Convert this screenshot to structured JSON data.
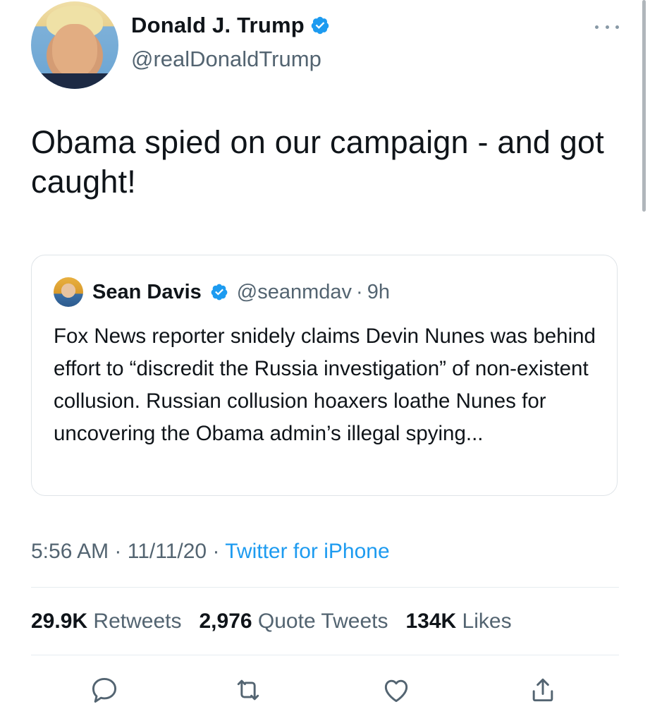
{
  "author": {
    "display_name": "Donald J. Trump",
    "handle": "@realDonaldTrump",
    "verified": true
  },
  "tweet": {
    "text": "Obama spied on our campaign - and got caught!"
  },
  "quoted_tweet": {
    "display_name": "Sean Davis",
    "handle": "@seanmdav",
    "separator": "·",
    "time": "9h",
    "verified": true,
    "text": "Fox News reporter snidely claims Devin Nunes was behind effort to “discredit the Russia investigation” of non-existent collusion. Russian collusion hoaxers loathe Nunes for uncovering the Obama admin’s illegal spying..."
  },
  "meta": {
    "time": "5:56 AM",
    "separator": "·",
    "date": "11/11/20",
    "source": "Twitter for iPhone"
  },
  "stats": {
    "retweets_count": "29.9K",
    "retweets_label": "Retweets",
    "quote_tweets_count": "2,976",
    "quote_tweets_label": "Quote Tweets",
    "likes_count": "134K",
    "likes_label": "Likes"
  },
  "colors": {
    "accent": "#1d9bf0",
    "text": "#0f1419",
    "secondary_text": "#536471",
    "border": "#dfe4e8"
  },
  "icons": {
    "more": "more-horizontal-icon",
    "verified": "verified-badge-icon",
    "reply": "reply-icon",
    "retweet": "retweet-icon",
    "like": "heart-icon",
    "share": "share-icon"
  }
}
